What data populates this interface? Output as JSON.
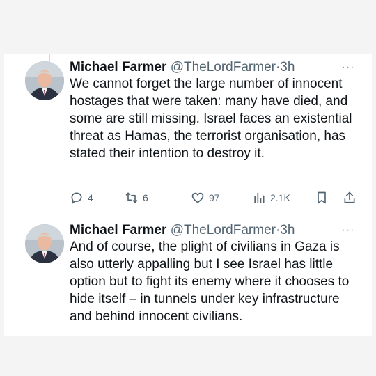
{
  "tweets": [
    {
      "author_name": "Michael Farmer",
      "handle": "@TheLordFarmer",
      "separator": "·",
      "time": "3h",
      "text": "We cannot forget the large number of innocent hostages that were taken: many have died, and some are still missing. Israel faces an existential threat as Hamas, the terrorist organisation, has stated their intention to destroy it.",
      "replies": "4",
      "retweets": "6",
      "likes": "97",
      "views": "2.1K"
    },
    {
      "author_name": "Michael Farmer",
      "handle": "@TheLordFarmer",
      "separator": "·",
      "time": "3h",
      "text": "And of course, the plight of civilians in Gaza is also utterly appalling but I see Israel has little option but to fight its enemy where it chooses to hide itself – in tunnels under key infrastructure and behind innocent civilians."
    }
  ],
  "more_label": "···",
  "icons": {
    "reply": "reply-icon",
    "retweet": "retweet-icon",
    "like": "heart-icon",
    "views": "views-chart-icon",
    "bookmark": "bookmark-icon",
    "share": "share-icon",
    "more": "more-dots-icon"
  },
  "colors": {
    "text": "#0f1419",
    "secondary": "#536471",
    "background": "#ffffff"
  }
}
